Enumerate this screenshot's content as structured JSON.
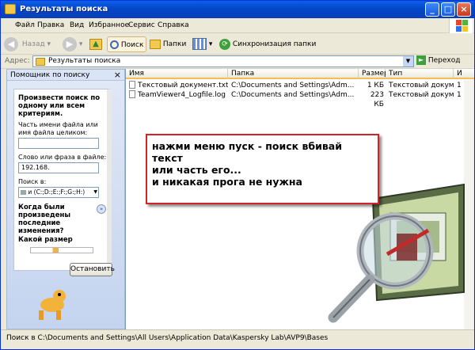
{
  "window": {
    "title": "Результаты поиска",
    "controls": [
      "_",
      "□",
      "×"
    ]
  },
  "menu": [
    "Файл",
    "Правка",
    "Вид",
    "Избранное",
    "Сервис",
    "Справка"
  ],
  "toolbar": {
    "back": "Назад",
    "search": "Поиск",
    "folders": "Папки",
    "sync": "Синхронизация папки"
  },
  "address": {
    "label": "Адрес:",
    "value": "Результаты поиска",
    "go": "Переход"
  },
  "sidebar": {
    "title": "Помощник по поиску",
    "heading": "Произвести поиск по одному или всем критериям.",
    "filename_label": "Часть имени файла или имя файла целиком:",
    "filename_value": "",
    "phrase_label": "Слово или фраза в файле:",
    "phrase_value": "192.168.",
    "search_in_label": "Поиск в:",
    "search_in_value": "и (C:;D:;E:;F:;G:;H:)",
    "modified_label": "Когда были произведены последние изменения?",
    "size_label": "Какой размер",
    "stop_button": "Остановить"
  },
  "list": {
    "columns": [
      "Имя",
      "Папка",
      "Размер",
      "Тип",
      "И"
    ],
    "rows": [
      {
        "name": "Текстовый документ.txt",
        "folder": "C:\\Documents and Settings\\Adm...",
        "size": "1 КБ",
        "type": "Текстовый документ",
        "extra": "1"
      },
      {
        "name": "TeamViewer4_Logfile.log",
        "folder": "C:\\Documents and Settings\\Adm...",
        "size": "223 КБ",
        "type": "Текстовый документ",
        "extra": "1"
      }
    ]
  },
  "callout": {
    "lines": [
      "нажми меню пуск - поиск вбивай текст",
      "или часть его...",
      "и никакая прога не нужна"
    ],
    "border_color": "#d2222a"
  },
  "status": "Поиск в C:\\Documents and Settings\\All Users\\Application Data\\Kaspersky Lab\\AVP9\\Bases",
  "colors": {
    "titlebar": "#0347c9",
    "window_bg": "#ece9d8",
    "list_header_accent": "#f5bd5a"
  },
  "icons": [
    "folder-icon",
    "back-arrow-icon",
    "forward-arrow-icon",
    "up-folder-icon",
    "search-icon",
    "folders-icon",
    "views-icon",
    "sync-icon",
    "go-arrow-icon",
    "text-file-icon",
    "search-dog-icon",
    "magnifier-illustration-icon"
  ]
}
